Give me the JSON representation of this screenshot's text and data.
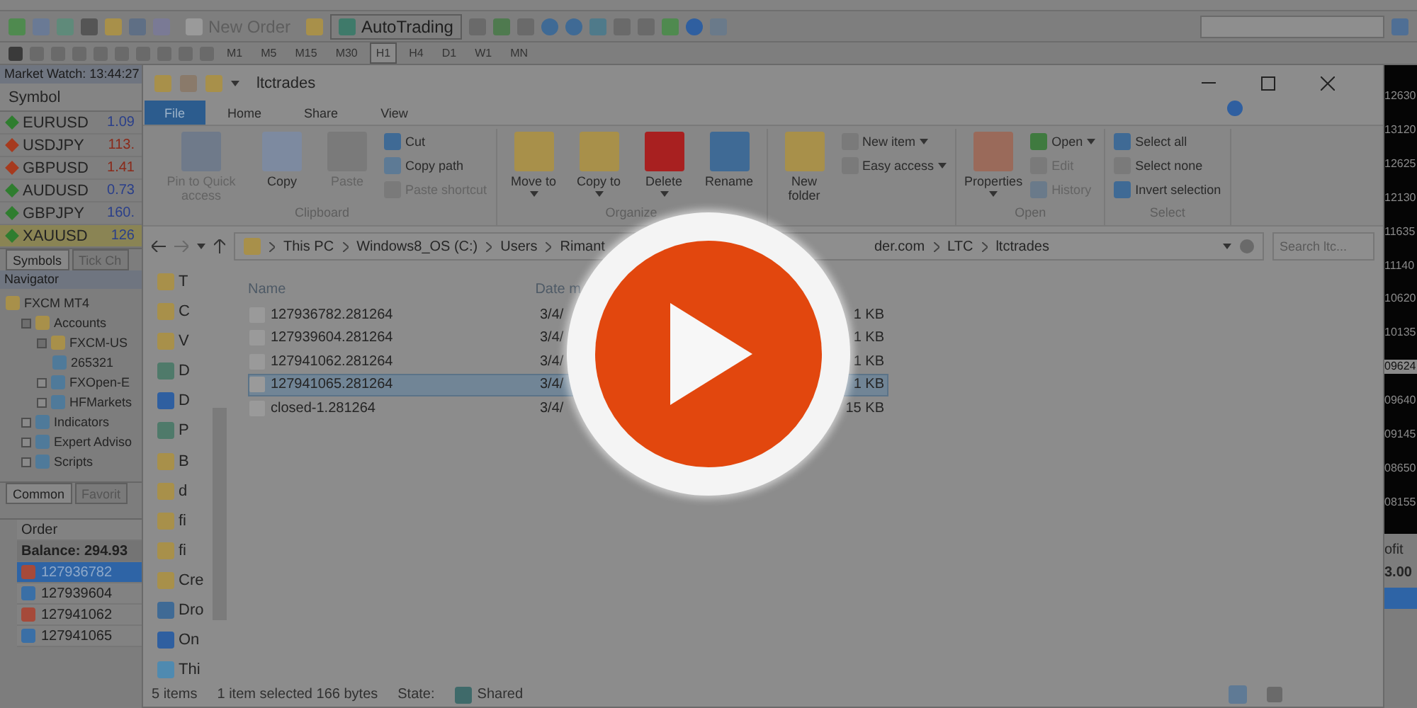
{
  "toolbar": {
    "buttons": [
      "New Order",
      "AutoTrading"
    ],
    "timeframes": [
      {
        "label": "M1",
        "selected": false
      },
      {
        "label": "M5",
        "selected": false
      },
      {
        "label": "M15",
        "selected": false
      },
      {
        "label": "M30",
        "selected": false
      },
      {
        "label": "H1",
        "selected": true
      },
      {
        "label": "H4",
        "selected": false
      },
      {
        "label": "D1",
        "selected": false
      },
      {
        "label": "W1",
        "selected": false
      },
      {
        "label": "MN",
        "selected": false
      }
    ]
  },
  "market_watch": {
    "title": "Market Watch: 13:44:27",
    "column": "Symbol",
    "rows": [
      {
        "symbol": "EURUSD",
        "price": "1.09",
        "falling": false,
        "selected": false
      },
      {
        "symbol": "USDJPY",
        "price": "113.",
        "falling": true,
        "selected": false
      },
      {
        "symbol": "GBPUSD",
        "price": "1.41",
        "falling": true,
        "selected": false
      },
      {
        "symbol": "AUDUSD",
        "price": "0.73",
        "falling": false,
        "selected": false
      },
      {
        "symbol": "GBPJPY",
        "price": "160.",
        "falling": false,
        "selected": false
      },
      {
        "symbol": "XAUUSD",
        "price": "126",
        "falling": false,
        "selected": true
      }
    ],
    "tabs": [
      {
        "label": "Symbols",
        "selected": true
      },
      {
        "label": "Tick Ch",
        "selected": false
      }
    ]
  },
  "navigator": {
    "title": "Navigator",
    "tree": [
      {
        "label": "FXCM MT4",
        "children": [
          {
            "label": "Accounts",
            "expanded": true,
            "children": [
              {
                "label": "FXCM-US",
                "expanded": true,
                "children": [
                  {
                    "label": "265321"
                  }
                ]
              },
              {
                "label": "FXOpen-E",
                "expanded": false
              },
              {
                "label": "HFMarkets",
                "expanded": false
              }
            ]
          },
          {
            "label": "Indicators",
            "expanded": false
          },
          {
            "label": "Expert Adviso",
            "expanded": false
          },
          {
            "label": "Scripts",
            "expanded": false
          }
        ]
      }
    ],
    "tabs": [
      {
        "label": "Common",
        "selected": true
      },
      {
        "label": "Favorit",
        "selected": false
      }
    ]
  },
  "terminal": {
    "column": "Order",
    "balance": "Balance: 294.93",
    "orders": [
      {
        "id": "127936782",
        "sell": true,
        "selected": true
      },
      {
        "id": "127939604",
        "sell": false,
        "selected": false
      },
      {
        "id": "127941062",
        "sell": true,
        "selected": false
      },
      {
        "id": "127941065",
        "sell": false,
        "selected": false
      }
    ],
    "profit_column": "ofit",
    "profit_balance": "3.00"
  },
  "chart": {
    "prices": [
      {
        "label": "12630",
        "current": false
      },
      {
        "label": "13120",
        "current": false
      },
      {
        "label": "12625",
        "current": false
      },
      {
        "label": "12130",
        "current": false
      },
      {
        "label": "11635",
        "current": false
      },
      {
        "label": "11140",
        "current": false
      },
      {
        "label": "10620",
        "current": false
      },
      {
        "label": "10135",
        "current": false
      },
      {
        "label": "09624",
        "current": true
      },
      {
        "label": "09640",
        "current": false
      },
      {
        "label": "09145",
        "current": false
      },
      {
        "label": "08650",
        "current": false
      },
      {
        "label": "08155",
        "current": false
      }
    ]
  },
  "explorer": {
    "title": "ltctrades",
    "tabs": [
      {
        "label": "File",
        "selected": true
      },
      {
        "label": "Home",
        "selected": false
      },
      {
        "label": "Share",
        "selected": false
      },
      {
        "label": "View",
        "selected": false
      }
    ],
    "ribbon": [
      {
        "label": "Clipboard",
        "items": [
          {
            "label": "Pin to Quick access",
            "kind": "large",
            "disabled": true,
            "menu": false
          },
          {
            "label": "Copy",
            "kind": "large",
            "disabled": false,
            "menu": false
          },
          {
            "label": "Paste",
            "kind": "large",
            "disabled": true,
            "menu": false
          },
          {
            "label": "Cut",
            "kind": "small",
            "disabled": false,
            "menu": false
          },
          {
            "label": "Copy path",
            "kind": "small",
            "disabled": false,
            "menu": false
          },
          {
            "label": "Paste shortcut",
            "kind": "small",
            "disabled": true,
            "menu": false
          }
        ]
      },
      {
        "label": "Organize",
        "items": [
          {
            "label": "Move to",
            "kind": "large",
            "disabled": false,
            "menu": true
          },
          {
            "label": "Copy to",
            "kind": "large",
            "disabled": false,
            "menu": true
          },
          {
            "label": "Delete",
            "kind": "large",
            "disabled": false,
            "menu": true
          },
          {
            "label": "Rename",
            "kind": "large",
            "disabled": false,
            "menu": false
          }
        ]
      },
      {
        "items": [
          {
            "label": "New folder",
            "kind": "large",
            "disabled": false,
            "menu": false
          },
          {
            "label": "New item",
            "kind": "small",
            "disabled": false,
            "menu": true
          },
          {
            "label": "Easy access",
            "kind": "small",
            "disabled": false,
            "menu": true
          }
        ]
      },
      {
        "label": "Open",
        "items": [
          {
            "label": "Properties",
            "kind": "large",
            "disabled": false,
            "menu": true
          },
          {
            "label": "Open",
            "kind": "small",
            "disabled": false,
            "menu": true
          },
          {
            "label": "Edit",
            "kind": "small",
            "disabled": true,
            "menu": false
          },
          {
            "label": "History",
            "kind": "small",
            "disabled": true,
            "menu": false
          }
        ]
      },
      {
        "label": "Select",
        "items": [
          {
            "label": "Select all",
            "kind": "small",
            "disabled": false,
            "menu": false
          },
          {
            "label": "Select none",
            "kind": "small",
            "disabled": false,
            "menu": false
          },
          {
            "label": "Invert selection",
            "kind": "small",
            "disabled": false,
            "menu": false
          }
        ]
      }
    ],
    "path_before": [
      "This PC",
      "Windows8_OS (C:)",
      "Users",
      "Rimant"
    ],
    "path_after": [
      "der.com",
      "LTC",
      "ltctrades"
    ],
    "search_placeholder": "Search ltc...",
    "nav": [
      "T",
      "C",
      "V",
      "D",
      "D",
      "P",
      "B",
      "d",
      "fi",
      "fi",
      "Cre",
      "Dro",
      "On",
      "Thi"
    ],
    "columns": [
      "Name",
      "Date m"
    ],
    "files": [
      {
        "name": "127936782.281264",
        "date": "3/4/",
        "size": "1 KB",
        "selected": false
      },
      {
        "name": "127939604.281264",
        "date": "3/4/",
        "size": "1 KB",
        "selected": false
      },
      {
        "name": "127941062.281264",
        "date": "3/4/",
        "size": "1 KB",
        "selected": false
      },
      {
        "name": "127941065.281264",
        "date": "3/4/",
        "size": "1 KB",
        "selected": true
      },
      {
        "name": "closed-1.281264",
        "date": "3/4/",
        "size": "15 KB",
        "selected": false
      }
    ],
    "status": {
      "count": "5 items",
      "selection": "1 item selected  166 bytes",
      "state_label": "State:",
      "state_value": "Shared"
    }
  }
}
